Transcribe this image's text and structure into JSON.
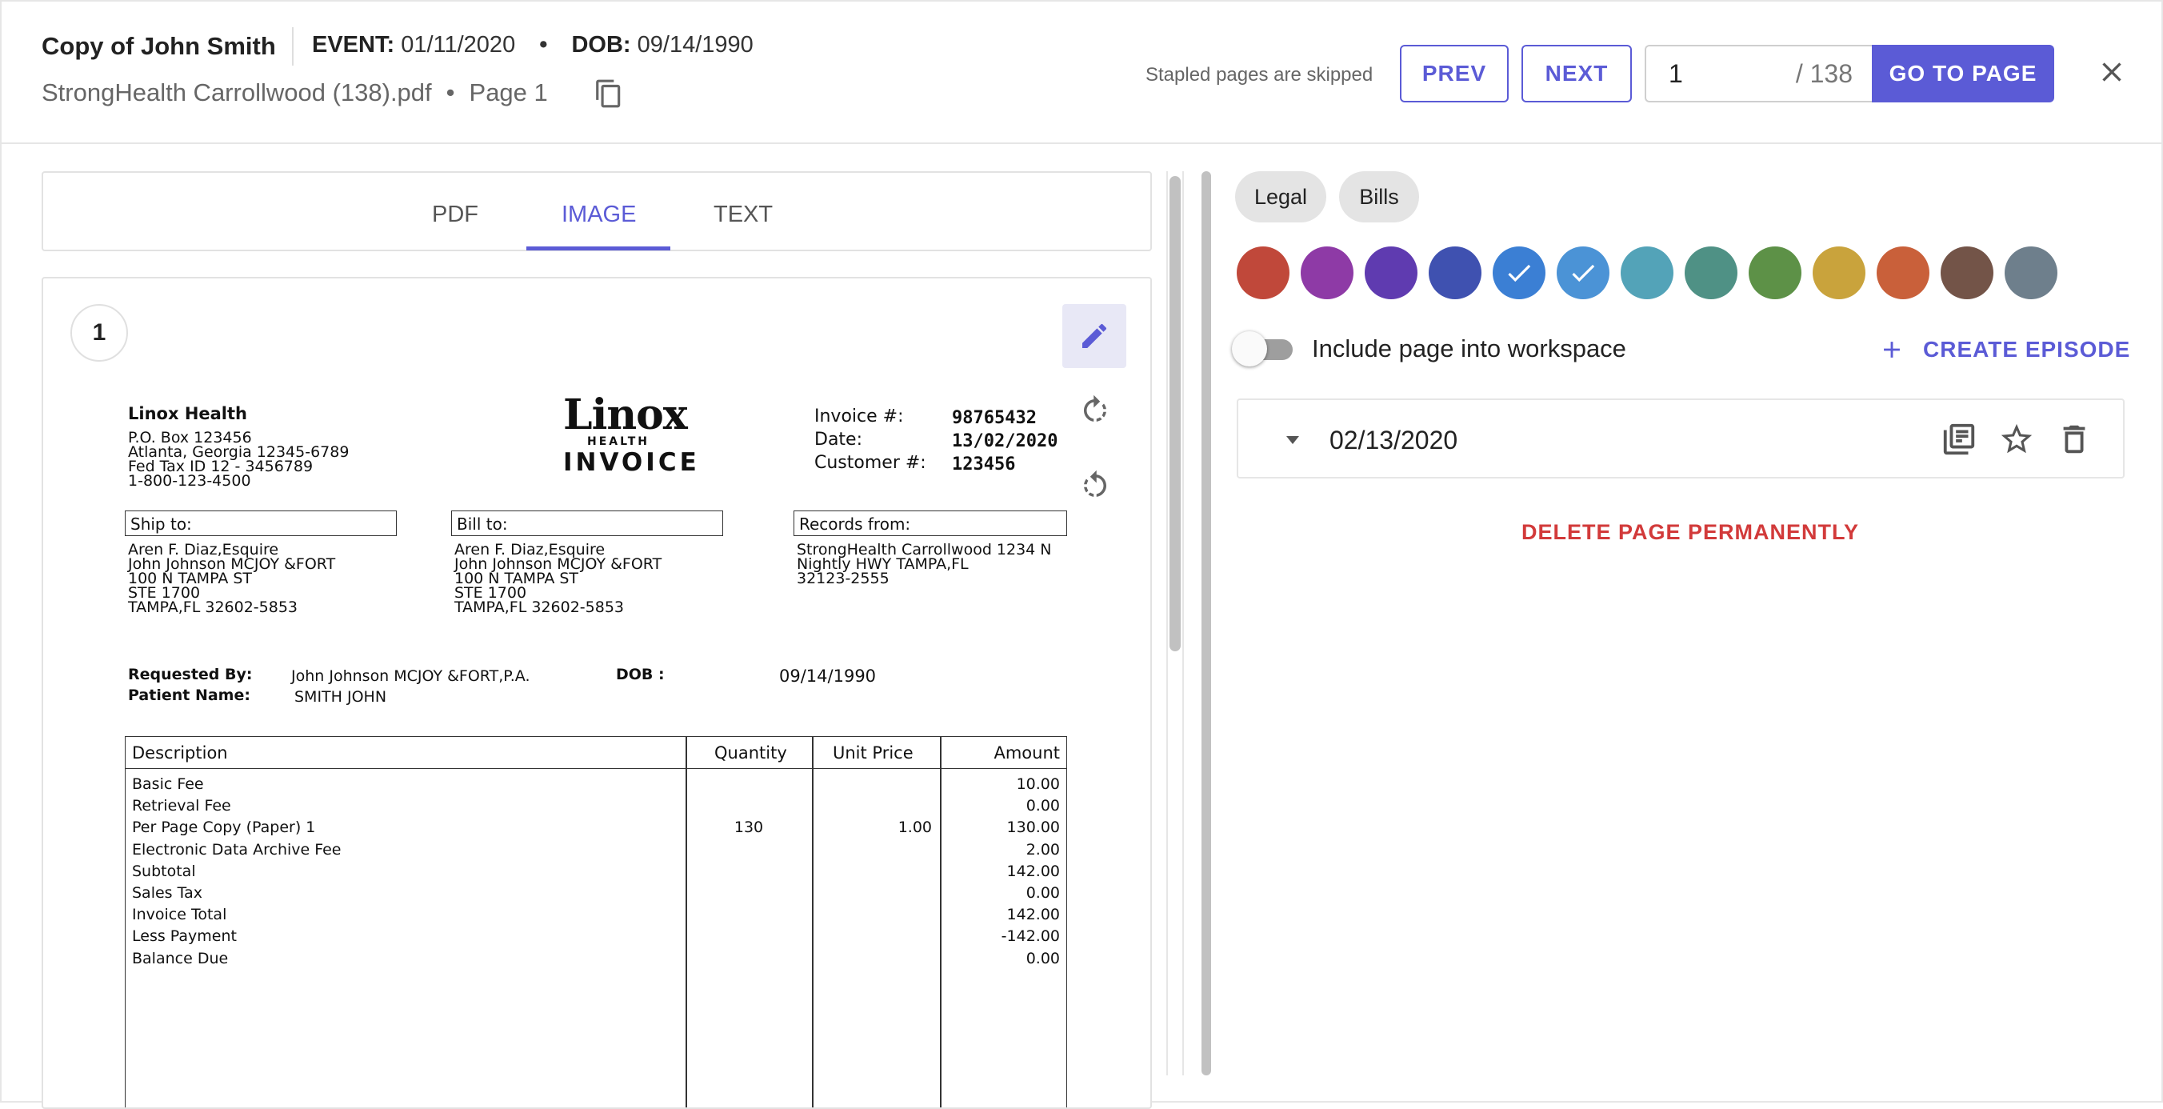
{
  "header": {
    "title": "Copy of John Smith",
    "event_label": "EVENT:",
    "event_value": "01/11/2020",
    "dob_label": "DOB:",
    "dob_value": "09/14/1990",
    "filename": "StrongHealth Carrollwood (138).pdf",
    "page_label": "Page 1",
    "stapled_note": "Stapled pages are skipped",
    "prev_label": "PREV",
    "next_label": "NEXT",
    "page_input_value": "1",
    "page_total": "/ 138",
    "go_label": "GO TO PAGE"
  },
  "viewer": {
    "tabs": [
      "PDF",
      "IMAGE",
      "TEXT"
    ],
    "active_tab": "IMAGE",
    "page_number": "1"
  },
  "invoice": {
    "company": "Linox Health",
    "address": [
      "P.O. Box 123456",
      "Atlanta, Georgia 12345-6789",
      "Fed Tax ID 12 - 3456789",
      "1-800-123-4500"
    ],
    "logo_main": "Linox",
    "logo_sub": "HEALTH",
    "logo_invoice": "INVOICE",
    "invoice_no_label": "Invoice #:",
    "invoice_no": "98765432",
    "date_label": "Date:",
    "date": "13/02/2020",
    "customer_label": "Customer #:",
    "customer": "123456",
    "ship_to_label": "Ship to:",
    "ship_to": [
      "Aren F. Diaz,Esquire",
      "John Johnson  MCJOY &FORT",
      "100 N TAMPA ST",
      "STE 1700",
      "TAMPA,FL 32602-5853"
    ],
    "bill_to_label": "Bill to:",
    "bill_to": [
      "Aren F. Diaz,Esquire",
      "John Johnson  MCJOY &FORT",
      "100 N TAMPA ST",
      "STE 1700",
      "TAMPA,FL 32602-5853"
    ],
    "records_from_label": "Records from:",
    "records_from": [
      "StrongHealth Carrollwood 1234 N",
      "Nightly HWY TAMPA,FL",
      "32123-2555"
    ],
    "requested_by_label": "Requested By:",
    "requested_by": "John Johnson  MCJOY &FORT,P.A.",
    "dob_label": "DOB :",
    "dob": "09/14/1990",
    "patient_label": "Patient Name:",
    "patient": "SMITH JOHN",
    "columns": [
      "Description",
      "Quantity",
      "Unit Price",
      "Amount"
    ],
    "rows": [
      {
        "description": "Basic Fee",
        "quantity": "",
        "unit_price": "",
        "amount": "10.00"
      },
      {
        "description": "Retrieval Fee",
        "quantity": "",
        "unit_price": "",
        "amount": "0.00"
      },
      {
        "description": "Per Page Copy (Paper) 1",
        "quantity": "130",
        "unit_price": "1.00",
        "amount": "130.00"
      },
      {
        "description": "Electronic Data Archive Fee",
        "quantity": "",
        "unit_price": "",
        "amount": "2.00"
      },
      {
        "description": "Subtotal",
        "quantity": "",
        "unit_price": "",
        "amount": "142.00"
      },
      {
        "description": "Sales Tax",
        "quantity": "",
        "unit_price": "",
        "amount": "0.00"
      },
      {
        "description": "Invoice Total",
        "quantity": "",
        "unit_price": "",
        "amount": "142.00"
      },
      {
        "description": "Less Payment",
        "quantity": "",
        "unit_price": "",
        "amount": "-142.00"
      },
      {
        "description": "Balance Due",
        "quantity": "",
        "unit_price": "",
        "amount": "0.00"
      }
    ]
  },
  "sidebar": {
    "tags": [
      "Legal",
      "Bills"
    ],
    "colors": [
      {
        "hex": "#c0483a",
        "checked": false
      },
      {
        "hex": "#8e3aa6",
        "checked": false
      },
      {
        "hex": "#5f3bb0",
        "checked": false
      },
      {
        "hex": "#3f51b0",
        "checked": false
      },
      {
        "hex": "#3b7fd4",
        "checked": true
      },
      {
        "hex": "#4b93d6",
        "checked": true
      },
      {
        "hex": "#53a3b8",
        "checked": false
      },
      {
        "hex": "#4f9185",
        "checked": false
      },
      {
        "hex": "#5d9147",
        "checked": false
      },
      {
        "hex": "#c9a33c",
        "checked": false
      },
      {
        "hex": "#c9603a",
        "checked": false
      },
      {
        "hex": "#735448",
        "checked": false
      },
      {
        "hex": "#6e7f8c",
        "checked": false
      }
    ],
    "include_label": "Include page into workspace",
    "include_enabled": false,
    "create_episode_label": "CREATE EPISODE",
    "episode_date": "02/13/2020",
    "delete_label": "DELETE PAGE PERMANENTLY"
  },
  "theme": {
    "accent": "#5b5bd6",
    "danger": "#d23a3a"
  }
}
